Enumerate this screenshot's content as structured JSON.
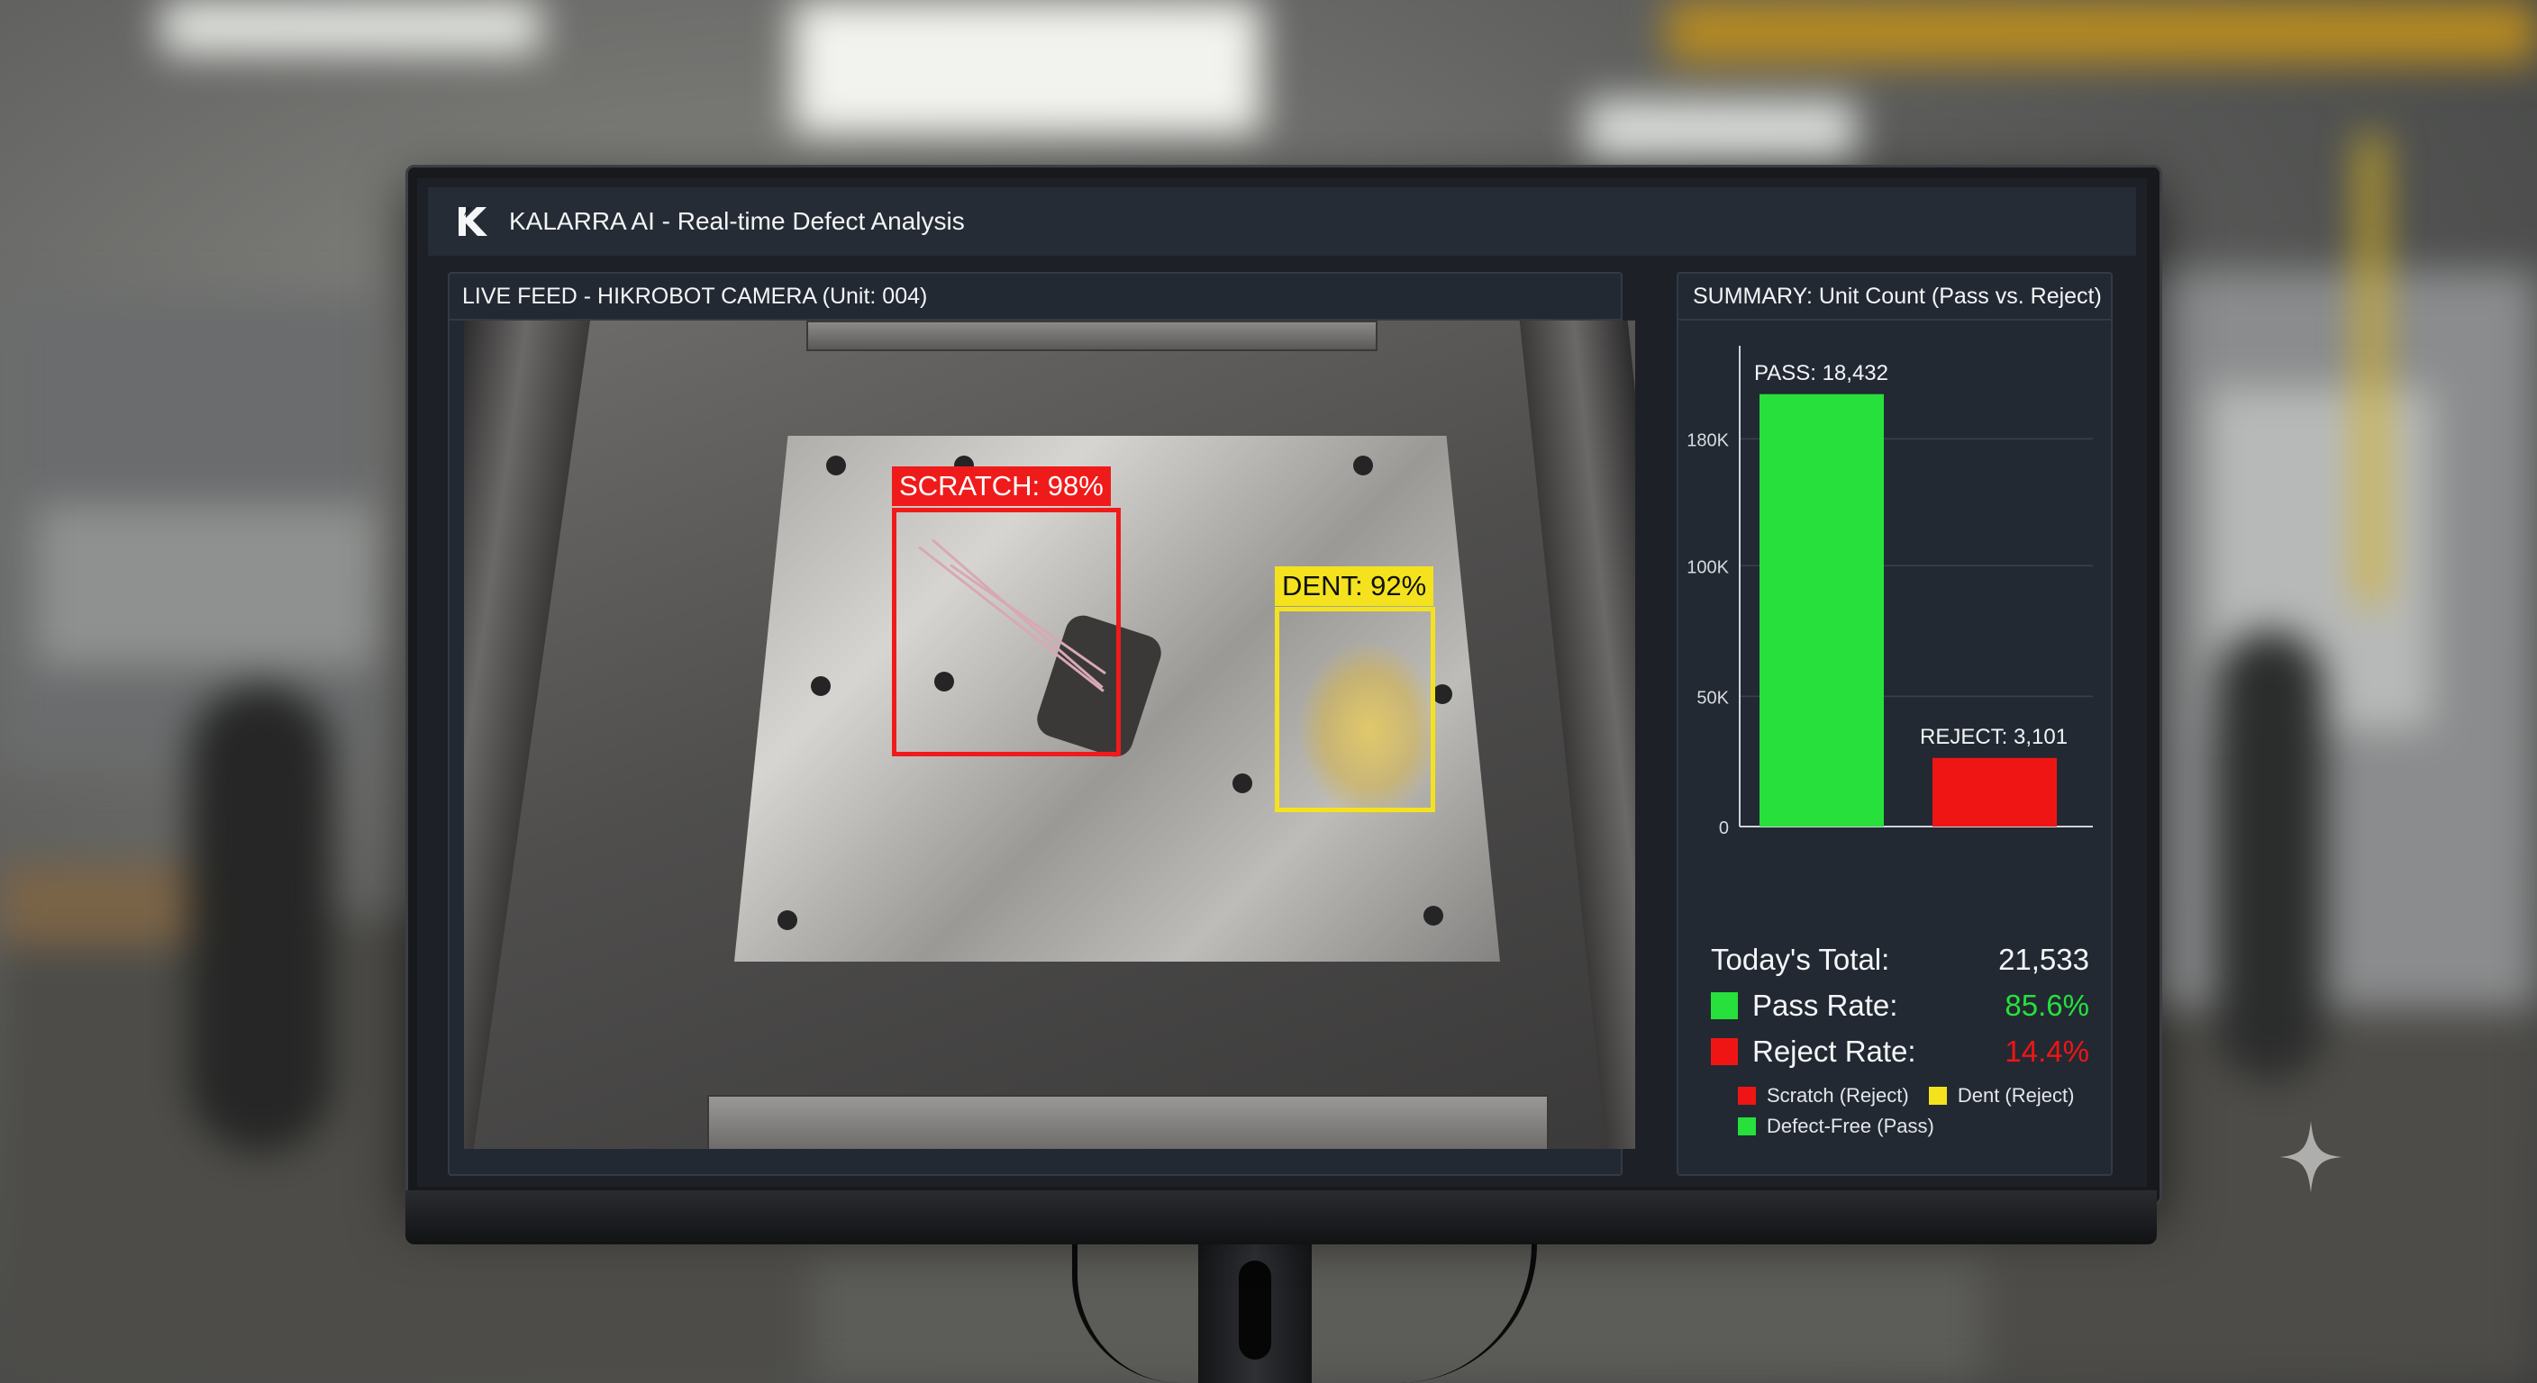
{
  "colors": {
    "pass": "#27e03c",
    "reject": "#f01515",
    "dent": "#f4e21e",
    "panel_bg": "#222933"
  },
  "app": {
    "title": "KALARRA AI - Real-time Defect Analysis",
    "logo_icon": "k-logo-icon"
  },
  "feed": {
    "title": "LIVE FEED - HIKROBOT CAMERA (Unit: 004)",
    "detections": [
      {
        "label": "SCRATCH: 98%",
        "color": "#ef1b1b"
      },
      {
        "label": "DENT: 92%",
        "color": "#f4e21e"
      }
    ]
  },
  "summary": {
    "title": "SUMMARY: Unit Count (Pass vs. Reject)",
    "today_total_label": "Today's Total:",
    "today_total_value": "21,533",
    "pass_rate_label": "Pass Rate:",
    "pass_rate_value": "85.6%",
    "reject_rate_label": "Reject Rate:",
    "reject_rate_value": "14.4%",
    "legend": [
      {
        "label": "Scratch (Reject)",
        "color": "#f01515"
      },
      {
        "label": "Dent (Reject)",
        "color": "#f4e21e"
      },
      {
        "label": "Defect-Free (Pass)",
        "color": "#27e03c"
      }
    ]
  },
  "chart_data": {
    "type": "bar",
    "categories": [
      "PASS",
      "REJECT"
    ],
    "values": [
      18432,
      3101
    ],
    "data_labels": [
      "PASS: 18,432",
      "REJECT: 3,101"
    ],
    "bar_colors": [
      "#27e03c",
      "#f01515"
    ],
    "yticks": [
      0,
      50000,
      100000,
      180000
    ],
    "ytick_labels": [
      "0",
      "50K",
      "100K",
      "180K"
    ],
    "ytick_levels": [
      0,
      0.277,
      0.555,
      0.825
    ],
    "bar_levels": [
      0.92,
      0.146
    ],
    "grid": true,
    "title": "SUMMARY: Unit Count (Pass vs. Reject)"
  }
}
